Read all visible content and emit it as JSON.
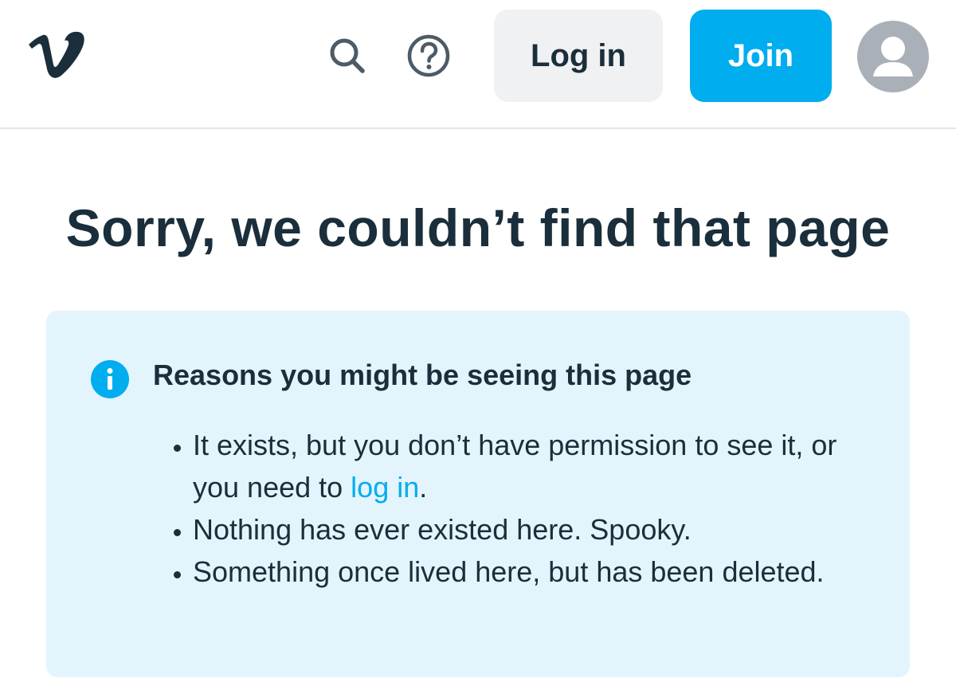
{
  "header": {
    "logo_icon": "vimeo-logo-icon",
    "search_icon": "search-icon",
    "help_icon": "help-circle-icon",
    "login_label": "Log in",
    "join_label": "Join",
    "avatar_icon": "user-avatar-icon"
  },
  "main": {
    "title": "Sorry, we couldn’t find that page",
    "notice": {
      "icon": "info-icon",
      "heading": "Reasons you might be seeing this page",
      "reason_1_text": "It exists, but you don’t have permission to see it, or you need to ",
      "reason_1_link": "log in",
      "reason_1_end": ".",
      "reason_2": "Nothing has ever existed here. Spooky.",
      "reason_3": "Something once lived here, but has been deleted."
    }
  },
  "colors": {
    "brand_dark": "#1a2e3b",
    "accent_blue": "#00adef",
    "notice_bg": "#e3f4fc",
    "login_bg": "#f0f1f2",
    "avatar_bg": "#a9b0b7"
  }
}
